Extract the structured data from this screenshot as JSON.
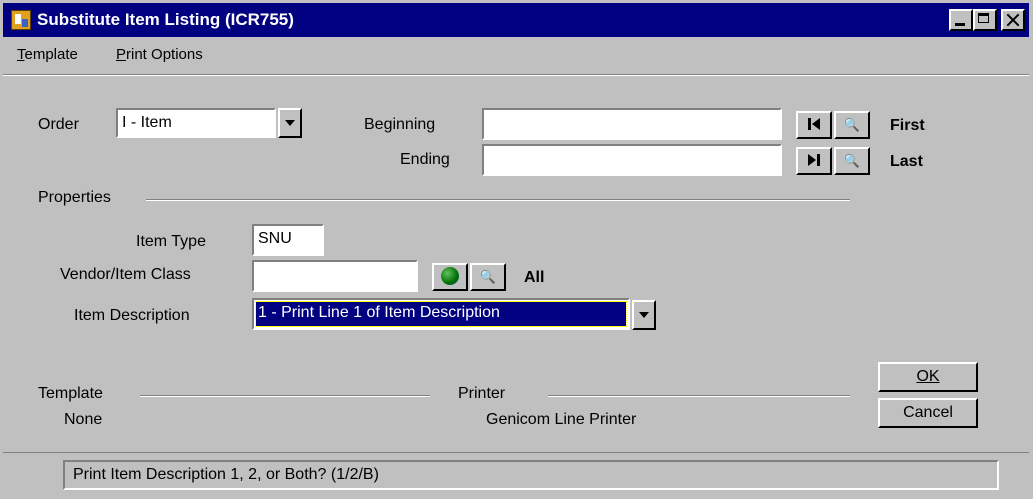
{
  "window": {
    "title": "Substitute Item Listing (ICR755)",
    "titlebar_color": "#000080",
    "controls": [
      "minimize-icon",
      "maximize-icon",
      "close-icon"
    ]
  },
  "menu": {
    "items": [
      {
        "label": "Template",
        "mnemonic": "T"
      },
      {
        "label": "Print Options",
        "mnemonic": "P"
      }
    ]
  },
  "order": {
    "label": "Order",
    "value": "I - Item"
  },
  "range": {
    "beginning_label": "Beginning",
    "beginning_value": "",
    "ending_label": "Ending",
    "ending_value": "",
    "first_label": "First",
    "last_label": "Last",
    "binoculars_glyph": "🔍"
  },
  "properties": {
    "heading": "Properties",
    "item_type_label": "Item Type",
    "item_type_value": "SNU",
    "vendor_class_label": "Vendor/Item Class",
    "vendor_class_value": "",
    "all_label": "All",
    "item_desc_label": "Item Description",
    "item_desc_value": "1 - Print Line 1 of Item Description",
    "selection_color": "#000080"
  },
  "template": {
    "heading": "Template",
    "value": "None"
  },
  "printer": {
    "heading": "Printer",
    "value": "Genicom Line Printer"
  },
  "buttons": {
    "ok": "OK",
    "cancel": "Cancel"
  },
  "status": {
    "text": "Print Item Description 1, 2, or Both? (1/2/B)"
  }
}
